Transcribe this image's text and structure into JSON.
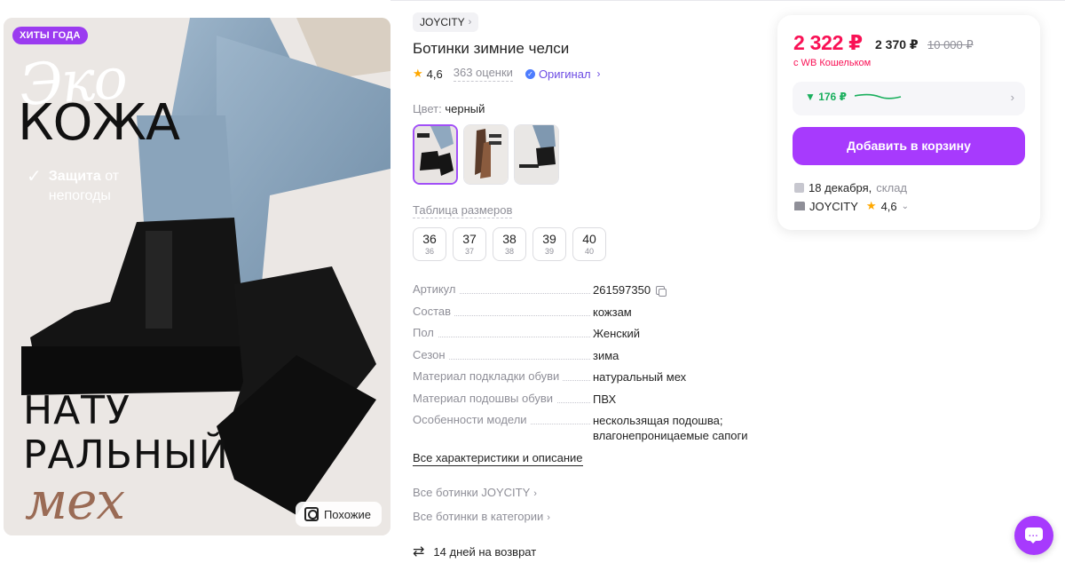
{
  "photo": {
    "badge": "ХИТЫ ГОДА",
    "headline_script": "Эко",
    "headline_main": "КОЖА",
    "protection_check": "✓",
    "protection_bold": "Защита",
    "protection_rest": "от",
    "protection_line2": "непогоды",
    "natu_line1": "НАТУ",
    "natu_line2": "РАЛЬНЫЙ",
    "natu_script": "мех",
    "similar_label": "Похожие"
  },
  "product": {
    "brand": "JOYCITY",
    "title": "Ботинки зимние челси",
    "rating": "4,6",
    "reviews": "363 оценки",
    "original_label": "Оригинал",
    "color_label": "Цвет:",
    "color_value": "черный",
    "size_table_label": "Таблица размеров",
    "sizes": [
      {
        "size": "36",
        "ru": "36"
      },
      {
        "size": "37",
        "ru": "37"
      },
      {
        "size": "38",
        "ru": "38"
      },
      {
        "size": "39",
        "ru": "39"
      },
      {
        "size": "40",
        "ru": "40"
      }
    ],
    "specs": [
      {
        "key": "Артикул",
        "value": "261597350"
      },
      {
        "key": "Состав",
        "value": "кожзам"
      },
      {
        "key": "Пол",
        "value": "Женский"
      },
      {
        "key": "Сезон",
        "value": "зима"
      },
      {
        "key": "Материал подкладки обуви",
        "value": "натуральный мех"
      },
      {
        "key": "Материал подошвы обуви",
        "value": "ПВХ"
      },
      {
        "key": "Особенности модели",
        "value_line1": "нескользящая подошва;",
        "value_line2": "влагонепроницаемые сапоги"
      }
    ],
    "all_chars_label": "Все характеристики и описание",
    "brand_link": "Все ботинки JOYCITY",
    "category_link": "Все ботинки в категории",
    "return_label": "14 дней на возврат"
  },
  "price": {
    "wallet_price": "2 322 ₽",
    "price": "2 370 ₽",
    "old_price": "10 000 ₽",
    "wallet_note": "с WB Кошельком",
    "history_delta": "▼ 176 ₽",
    "add_to_cart": "Добавить в корзину",
    "delivery_date": "18 декабря,",
    "delivery_from": "склад",
    "seller": "JOYCITY",
    "seller_rating": "4,6"
  },
  "colors": {
    "accent": "#a73afd",
    "price_red": "#f91155",
    "green": "#1aaf5d",
    "star": "#ffa800"
  },
  "icons": [
    "similar-search-icon",
    "chevron-right-icon",
    "original-shield-icon",
    "star-icon",
    "copy-icon",
    "return-icon",
    "box-icon",
    "shop-icon",
    "chat-icon"
  ]
}
